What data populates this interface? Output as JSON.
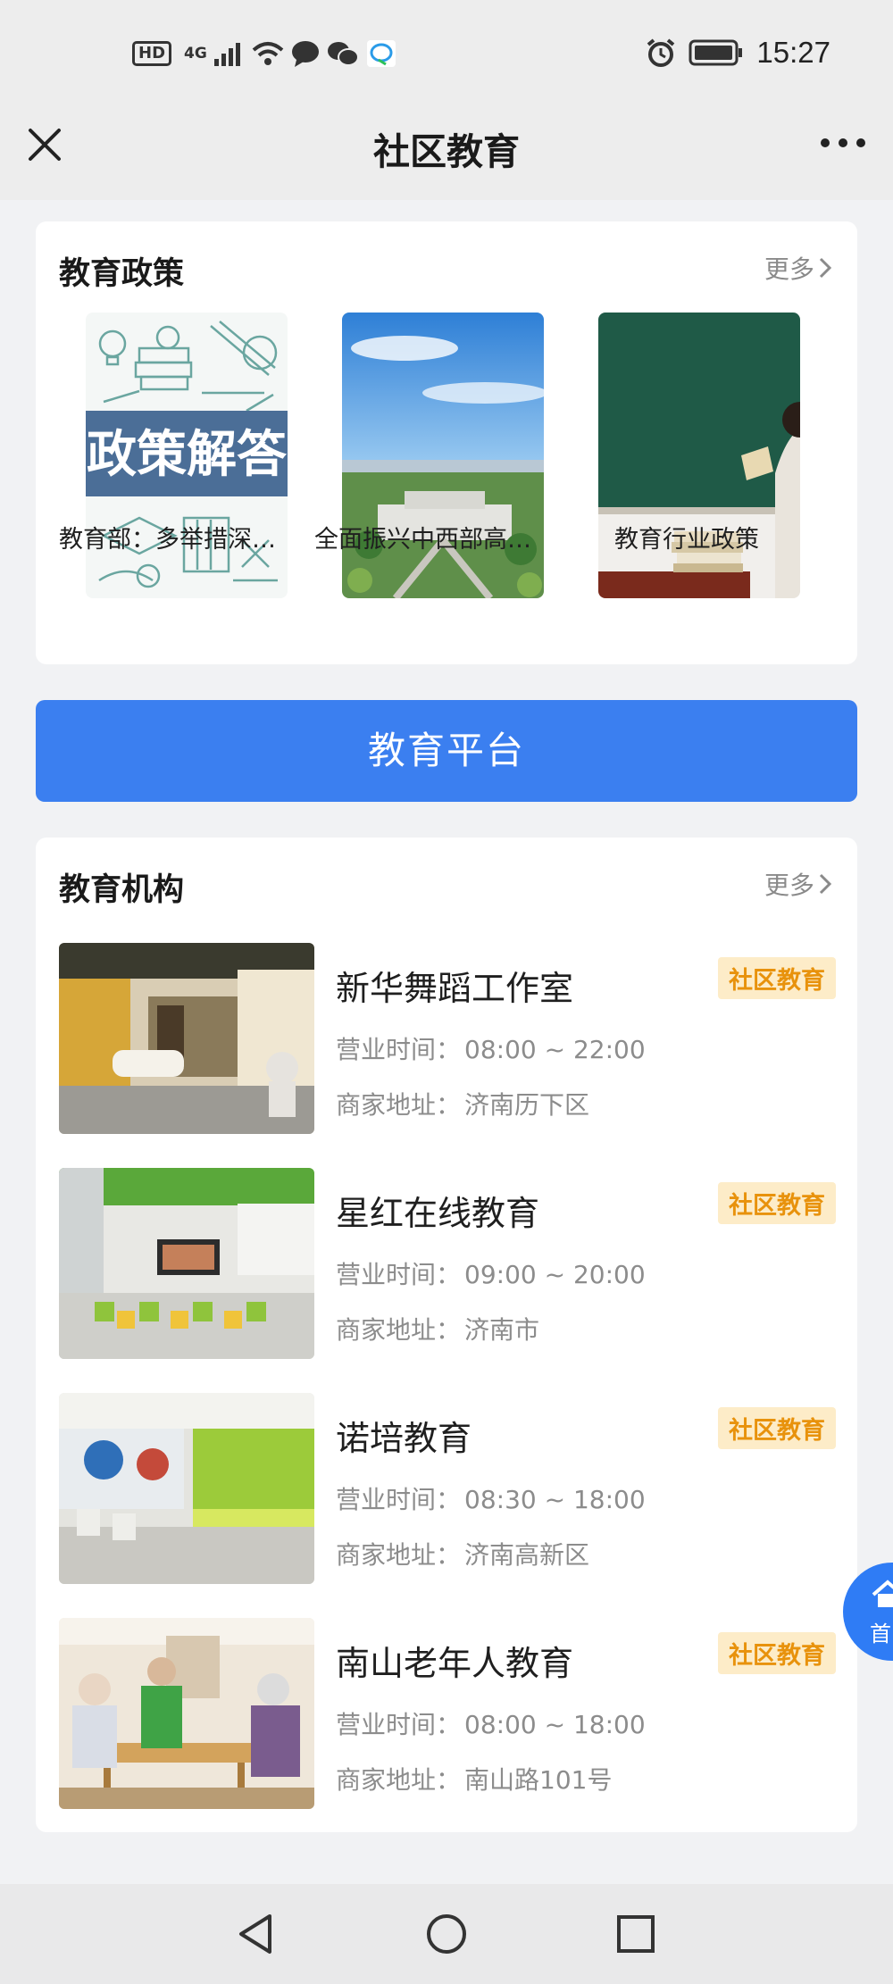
{
  "status_bar": {
    "hd_label": "HD",
    "network_label": "4G",
    "time": "15:27"
  },
  "nav": {
    "title": "社区教育"
  },
  "policy": {
    "title": "教育政策",
    "more_label": "更多",
    "items": [
      {
        "caption": "教育部：多举措深…",
        "image_text": "政策解答"
      },
      {
        "caption": "全面振兴中西部高…"
      },
      {
        "caption": "教育行业政策"
      }
    ]
  },
  "platform_button": {
    "label": "教育平台"
  },
  "institutions": {
    "title": "教育机构",
    "more_label": "更多",
    "hours_label": "营业时间：",
    "address_label": "商家地址：",
    "items": [
      {
        "name": "新华舞蹈工作室",
        "tag": "社区教育",
        "hours": "08:00 ~ 22:00",
        "address": "济南历下区"
      },
      {
        "name": "星红在线教育",
        "tag": "社区教育",
        "hours": "09:00 ~ 20:00",
        "address": "济南市"
      },
      {
        "name": "诺培教育",
        "tag": "社区教育",
        "hours": "08:30 ~ 18:00",
        "address": "济南高新区"
      },
      {
        "name": "南山老年人教育",
        "tag": "社区教育",
        "hours": "08:00 ~ 18:00",
        "address": "南山路101号"
      }
    ]
  },
  "float_button": {
    "label": "首"
  },
  "colors": {
    "accent": "#3b7ff0",
    "tag_bg": "#fdecc8",
    "tag_text": "#e8920c"
  }
}
